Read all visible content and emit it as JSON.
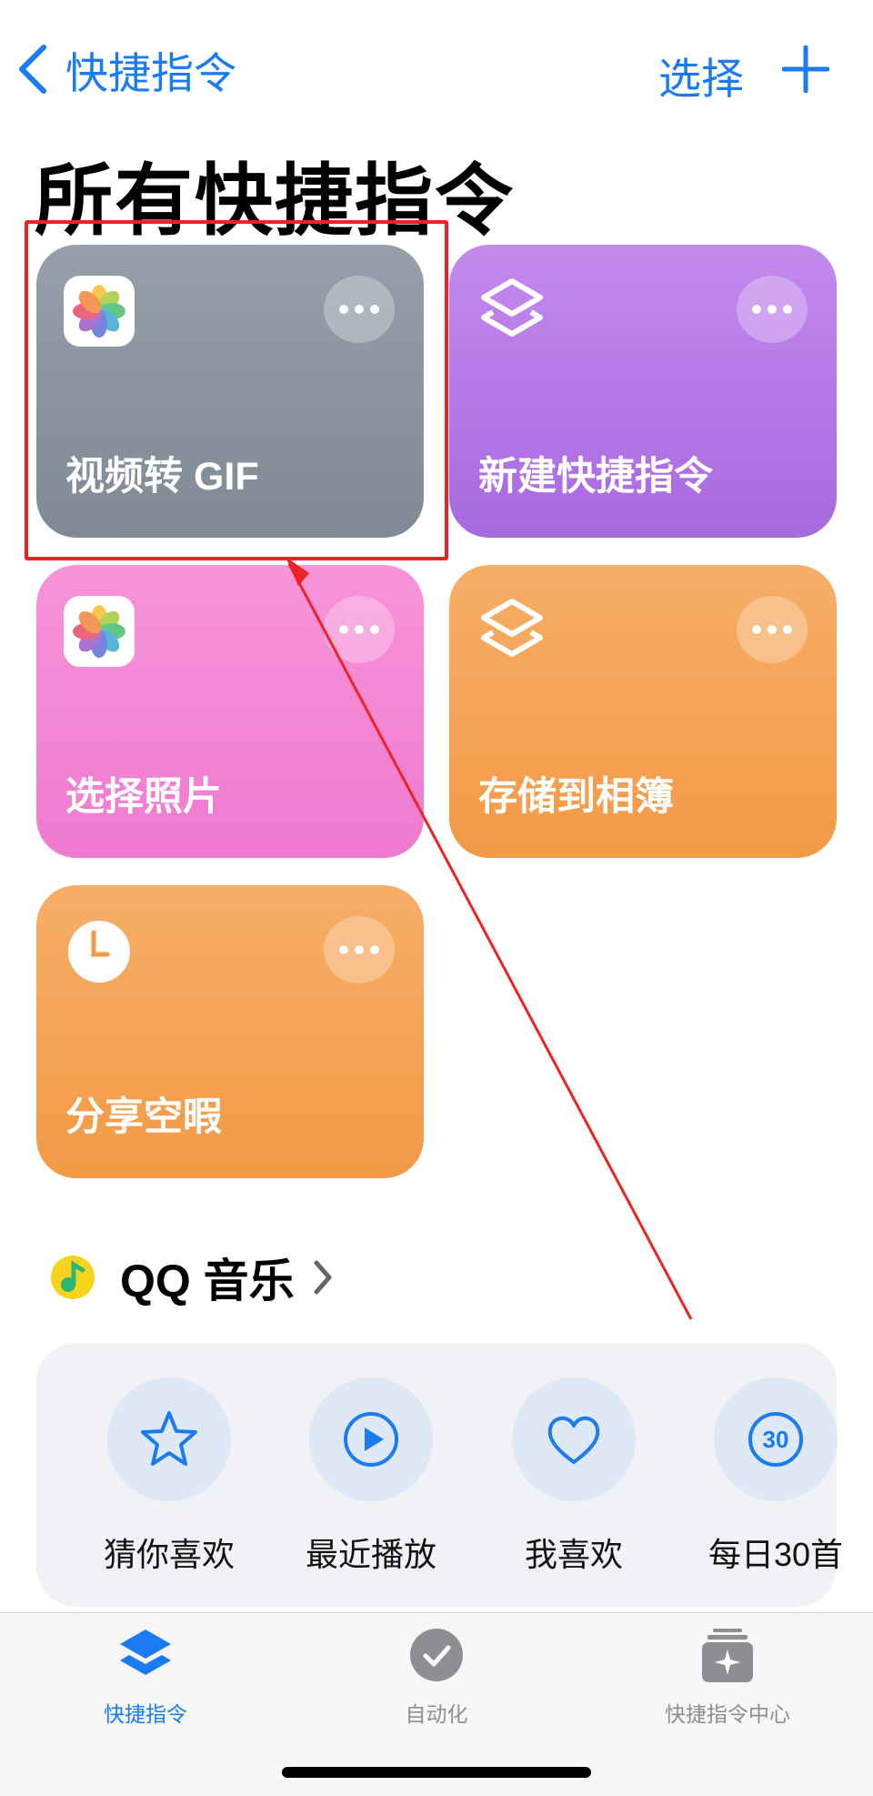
{
  "nav": {
    "back_label": "快捷指令",
    "select_label": "选择"
  },
  "page_title": "所有快捷指令",
  "shortcuts": [
    {
      "label": "视频转 GIF",
      "icon": "photos-icon",
      "color": "#8c96a1"
    },
    {
      "label": "新建快捷指令",
      "icon": "shortcuts-layers-icon",
      "color": "#b577e6"
    },
    {
      "label": "选择照片",
      "icon": "photos-icon",
      "color": "#f387d4"
    },
    {
      "label": "存储到相簿",
      "icon": "shortcuts-layers-icon",
      "color": "#f4a455"
    },
    {
      "label": "分享空暇",
      "icon": "clock-icon",
      "color": "#f4a455"
    }
  ],
  "qq_music": {
    "title": "QQ 音乐",
    "items": [
      {
        "label": "猜你喜欢",
        "icon": "star-icon"
      },
      {
        "label": "最近播放",
        "icon": "play-icon"
      },
      {
        "label": "我喜欢",
        "icon": "heart-icon"
      },
      {
        "label": "每日30首",
        "icon": "daily-30-icon",
        "badge": "30"
      }
    ]
  },
  "tabbar": {
    "tabs": [
      {
        "label": "快捷指令",
        "active": true
      },
      {
        "label": "自动化",
        "active": false
      },
      {
        "label": "快捷指令中心",
        "active": false
      }
    ]
  },
  "colors": {
    "accent": "#1a7cf0",
    "highlight": "#ee2222"
  }
}
